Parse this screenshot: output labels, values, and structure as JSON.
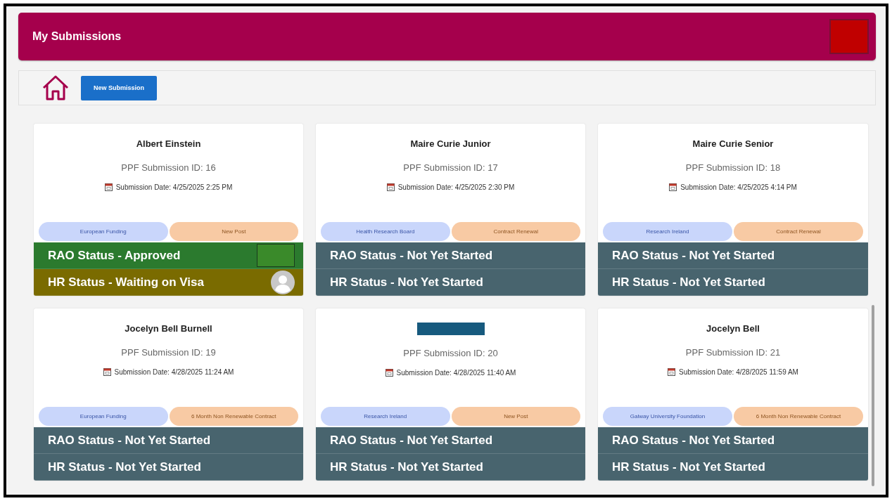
{
  "header": {
    "title": "My Submissions"
  },
  "toolbar": {
    "new_button": "New Submission"
  },
  "cards": [
    {
      "name": "Albert Einstein",
      "name_redacted": false,
      "id_text": "PPF Submission ID: 16",
      "date_text": "Submission Date: 4/25/2025 2:25 PM",
      "tags": [
        {
          "label": "European Funding",
          "color": "#c9d6fb"
        },
        {
          "label": "New Post",
          "color": "#f8caa4"
        }
      ],
      "statuses": [
        {
          "text": "RAO Status - Approved",
          "color": "#2b7a2e",
          "kind": "image"
        },
        {
          "text": "HR Status - Waiting on Visa",
          "color": "#7a6b00",
          "kind": "avatar"
        }
      ]
    },
    {
      "name": "Maire Curie Junior",
      "name_redacted": false,
      "id_text": "PPF Submission ID: 17",
      "date_text": "Submission Date: 4/25/2025 2:30 PM",
      "tags": [
        {
          "label": "Health Research Board",
          "color": "#c9d6fb"
        },
        {
          "label": "Contract Renewal",
          "color": "#f8caa4"
        }
      ],
      "statuses": [
        {
          "text": "RAO Status - Not Yet Started",
          "color": "#48646e",
          "kind": "plain"
        },
        {
          "text": "HR Status - Not Yet Started",
          "color": "#48646e",
          "kind": "plain"
        }
      ]
    },
    {
      "name": "Maire Curie Senior",
      "name_redacted": false,
      "id_text": "PPF Submission ID: 18",
      "date_text": "Submission Date: 4/25/2025 4:14 PM",
      "tags": [
        {
          "label": "Research Ireland",
          "color": "#c9d6fb"
        },
        {
          "label": "Contract Renewal",
          "color": "#f8caa4"
        }
      ],
      "statuses": [
        {
          "text": "RAO Status - Not Yet Started",
          "color": "#48646e",
          "kind": "plain"
        },
        {
          "text": "HR Status - Not Yet Started",
          "color": "#48646e",
          "kind": "plain"
        }
      ]
    },
    {
      "name": "Jocelyn Bell Burnell",
      "name_redacted": false,
      "id_text": "PPF Submission ID: 19",
      "date_text": "Submission Date: 4/28/2025 11:24 AM",
      "tags": [
        {
          "label": "European Funding",
          "color": "#c9d6fb"
        },
        {
          "label": "6 Month Non Renewable Contract",
          "color": "#f8caa4"
        }
      ],
      "statuses": [
        {
          "text": "RAO Status - Not Yet Started",
          "color": "#48646e",
          "kind": "plain"
        },
        {
          "text": "HR Status - Not Yet Started",
          "color": "#48646e",
          "kind": "plain"
        }
      ]
    },
    {
      "name_redacted": true,
      "id_text": "PPF Submission ID: 20",
      "date_text": "Submission Date: 4/28/2025 11:40 AM",
      "tags": [
        {
          "label": "Research Ireland",
          "color": "#c9d6fb"
        },
        {
          "label": "New Post",
          "color": "#f8caa4"
        }
      ],
      "statuses": [
        {
          "text": "RAO Status - Not Yet Started",
          "color": "#48646e",
          "kind": "plain"
        },
        {
          "text": "HR Status - Not Yet Started",
          "color": "#48646e",
          "kind": "plain"
        }
      ]
    },
    {
      "name": "Jocelyn Bell",
      "name_redacted": false,
      "id_text": "PPF Submission ID: 21",
      "date_text": "Submission Date: 4/28/2025 11:59 AM",
      "tags": [
        {
          "label": "Galway University Foundation",
          "color": "#c9d6fb"
        },
        {
          "label": "6 Month Non Renewable Contract",
          "color": "#f8caa4"
        }
      ],
      "statuses": [
        {
          "text": "RAO Status - Not Yet Started",
          "color": "#48646e",
          "kind": "plain"
        },
        {
          "text": "HR Status - Not Yet Started",
          "color": "#48646e",
          "kind": "plain"
        }
      ]
    }
  ]
}
